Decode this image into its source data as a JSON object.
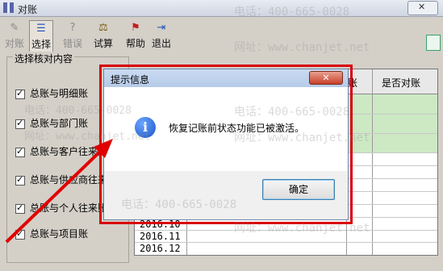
{
  "window": {
    "title": "对账"
  },
  "toolbar": {
    "buttons": [
      {
        "label": "对账",
        "icon": "reconcile-icon",
        "enabled": false
      },
      {
        "label": "选择",
        "icon": "select-icon",
        "enabled": true
      },
      {
        "label": "错误",
        "icon": "error-icon",
        "enabled": false
      },
      {
        "label": "试算",
        "icon": "trial-balance-icon",
        "enabled": true
      },
      {
        "label": "帮助",
        "icon": "help-icon",
        "enabled": true
      },
      {
        "label": "退出",
        "icon": "exit-icon",
        "enabled": true
      }
    ]
  },
  "selection": {
    "title": "选择核对内容",
    "items": [
      {
        "label": "总账与明细账",
        "checked": true
      },
      {
        "label": "总账与部门账",
        "checked": true
      },
      {
        "label": "总账与客户往来账",
        "checked": true
      },
      {
        "label": "总账与供应商往来账",
        "checked": true
      },
      {
        "label": "总账与个人往来账",
        "checked": true
      },
      {
        "label": "总账与项目账",
        "checked": true
      }
    ]
  },
  "grid": {
    "headers": {
      "col_partial": "账",
      "col_reconciled": "是否对账"
    },
    "periods": [
      "2016.10",
      "2016.11",
      "2016.12"
    ],
    "highlight_color": "#cce9c4"
  },
  "dialog": {
    "title": "提示信息",
    "message": "恢复记账前状态功能已被激活。",
    "ok_label": "确定",
    "icon": "info-icon",
    "info_glyph": "i",
    "close_glyph": "✕",
    "border_color": "#d8000a"
  },
  "watermark": {
    "phone": "电话：400-665-0028",
    "site": "网址：www.chanjet.net",
    "phone_fragment": "电话：400-665-0028",
    "site_fragment": "网址：www.chanjet.net"
  }
}
